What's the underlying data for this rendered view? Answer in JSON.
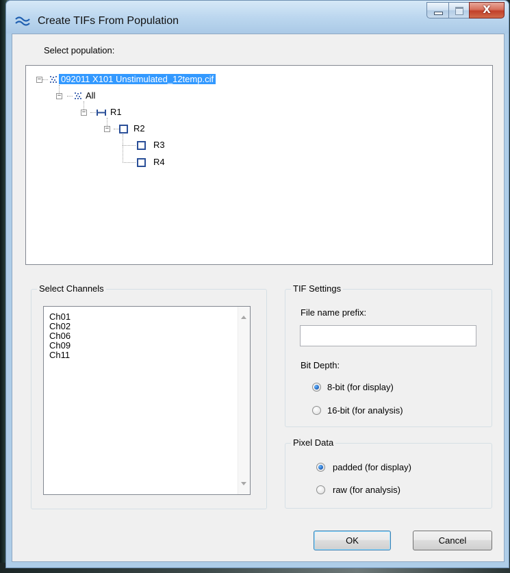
{
  "window": {
    "title": "Create TIFs From Population",
    "caption_buttons": [
      "minimize",
      "maximize",
      "close"
    ],
    "close_glyph": "X"
  },
  "population": {
    "label": "Select population:",
    "tree": [
      {
        "label": "092011 X101 Unstimulated_12temp.cif",
        "icon": "population-dots-icon",
        "selected": true
      },
      {
        "label": "All",
        "icon": "population-dots-icon"
      },
      {
        "label": "R1",
        "icon": "range-gate-icon"
      },
      {
        "label": "R2",
        "icon": "square-gate-icon"
      },
      {
        "label": "R3",
        "icon": "square-gate-icon"
      },
      {
        "label": "R4",
        "icon": "square-gate-icon"
      }
    ]
  },
  "channels": {
    "group_label": "Select Channels",
    "items": [
      "Ch01",
      "Ch02",
      "Ch06",
      "Ch09",
      "Ch11"
    ]
  },
  "tif_settings": {
    "group_label": "TIF Settings",
    "prefix_label": "File name prefix:",
    "prefix_value": "",
    "bit_depth_label": "Bit Depth:",
    "options": [
      {
        "label": "8-bit (for display)",
        "checked": true
      },
      {
        "label": "16-bit (for analysis)",
        "checked": false
      }
    ]
  },
  "pixel_data": {
    "group_label": "Pixel Data",
    "options": [
      {
        "label": "padded (for display)",
        "checked": true
      },
      {
        "label": "raw (for analysis)",
        "checked": false
      }
    ]
  },
  "buttons": {
    "ok": "OK",
    "cancel": "Cancel"
  },
  "colors": {
    "selection": "#3399ff",
    "gate_icon": "#2a4f98"
  }
}
